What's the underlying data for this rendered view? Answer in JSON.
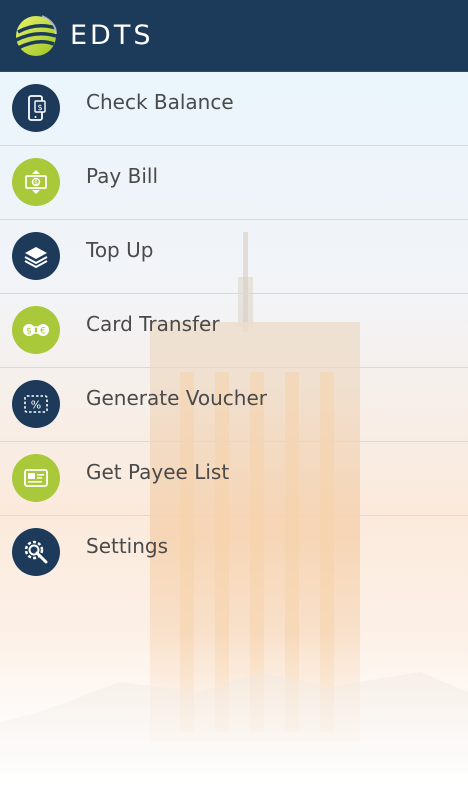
{
  "header": {
    "brand": "EDTS",
    "logo_icon": "globe-swirl-logo"
  },
  "colors": {
    "header_bg": "#1c3b5a",
    "icon_dark": "#1d3a5b",
    "icon_green": "#a9c93a",
    "label_text": "#4a4a4a",
    "divider": "#d9d9d9"
  },
  "menu": {
    "items": [
      {
        "label": "Check Balance",
        "icon": "mobile-balance-icon",
        "style": "dark"
      },
      {
        "label": "Pay Bill",
        "icon": "cash-bill-icon",
        "style": "green"
      },
      {
        "label": "Top Up",
        "icon": "layers-icon",
        "style": "dark"
      },
      {
        "label": "Card Transfer",
        "icon": "currency-exchange-icon",
        "style": "green"
      },
      {
        "label": "Generate Voucher",
        "icon": "percent-voucher-icon",
        "style": "dark"
      },
      {
        "label": "Get Payee List",
        "icon": "payee-card-icon",
        "style": "green"
      },
      {
        "label": "Settings",
        "icon": "gear-wrench-icon",
        "style": "dark"
      }
    ]
  }
}
